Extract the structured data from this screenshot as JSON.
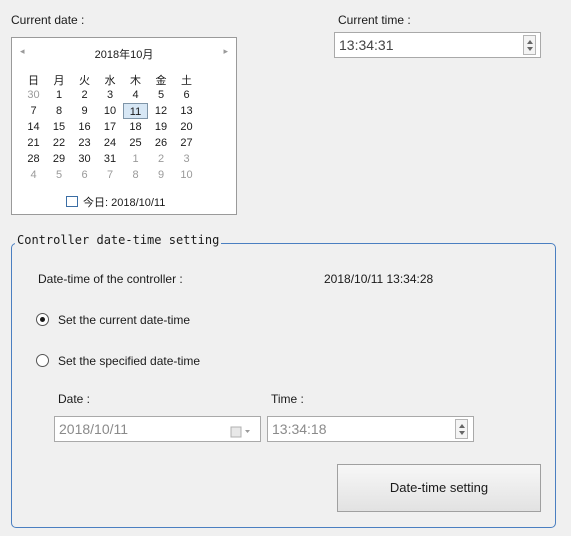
{
  "current_date": {
    "label": "Current date :",
    "calendar": {
      "prev_icon": "◂",
      "next_icon": "▸",
      "month_title": "2018年10月",
      "weekdays": [
        "日",
        "月",
        "火",
        "水",
        "木",
        "金",
        "土"
      ],
      "weeks": [
        [
          "30",
          "1",
          "2",
          "3",
          "4",
          "5",
          "6"
        ],
        [
          "7",
          "8",
          "9",
          "10",
          "11",
          "12",
          "13"
        ],
        [
          "14",
          "15",
          "16",
          "17",
          "18",
          "19",
          "20"
        ],
        [
          "21",
          "22",
          "23",
          "24",
          "25",
          "26",
          "27"
        ],
        [
          "28",
          "29",
          "30",
          "31",
          "1",
          "2",
          "3"
        ],
        [
          "4",
          "5",
          "6",
          "7",
          "8",
          "9",
          "10"
        ]
      ],
      "selected_day": "11",
      "today_text": "今日: 2018/10/11"
    }
  },
  "current_time": {
    "label": "Current time :",
    "value": "13:34:31"
  },
  "controller": {
    "group_title": "Controller date-time setting",
    "datetime_label": "Date-time of the controller :",
    "datetime_value": "2018/10/11 13:34:28",
    "radio_current": "Set the current date-time",
    "radio_specified": "Set the specified date-time",
    "selected_option": "current",
    "date_label": "Date :",
    "date_value": "2018/10/11",
    "time_label": "Time :",
    "time_value": "13:34:18",
    "button_label": "Date-time setting"
  },
  "icons": {
    "calendar_dropdown": "calendar-dropdown-icon",
    "spinner": "spinner-arrows-icon"
  }
}
